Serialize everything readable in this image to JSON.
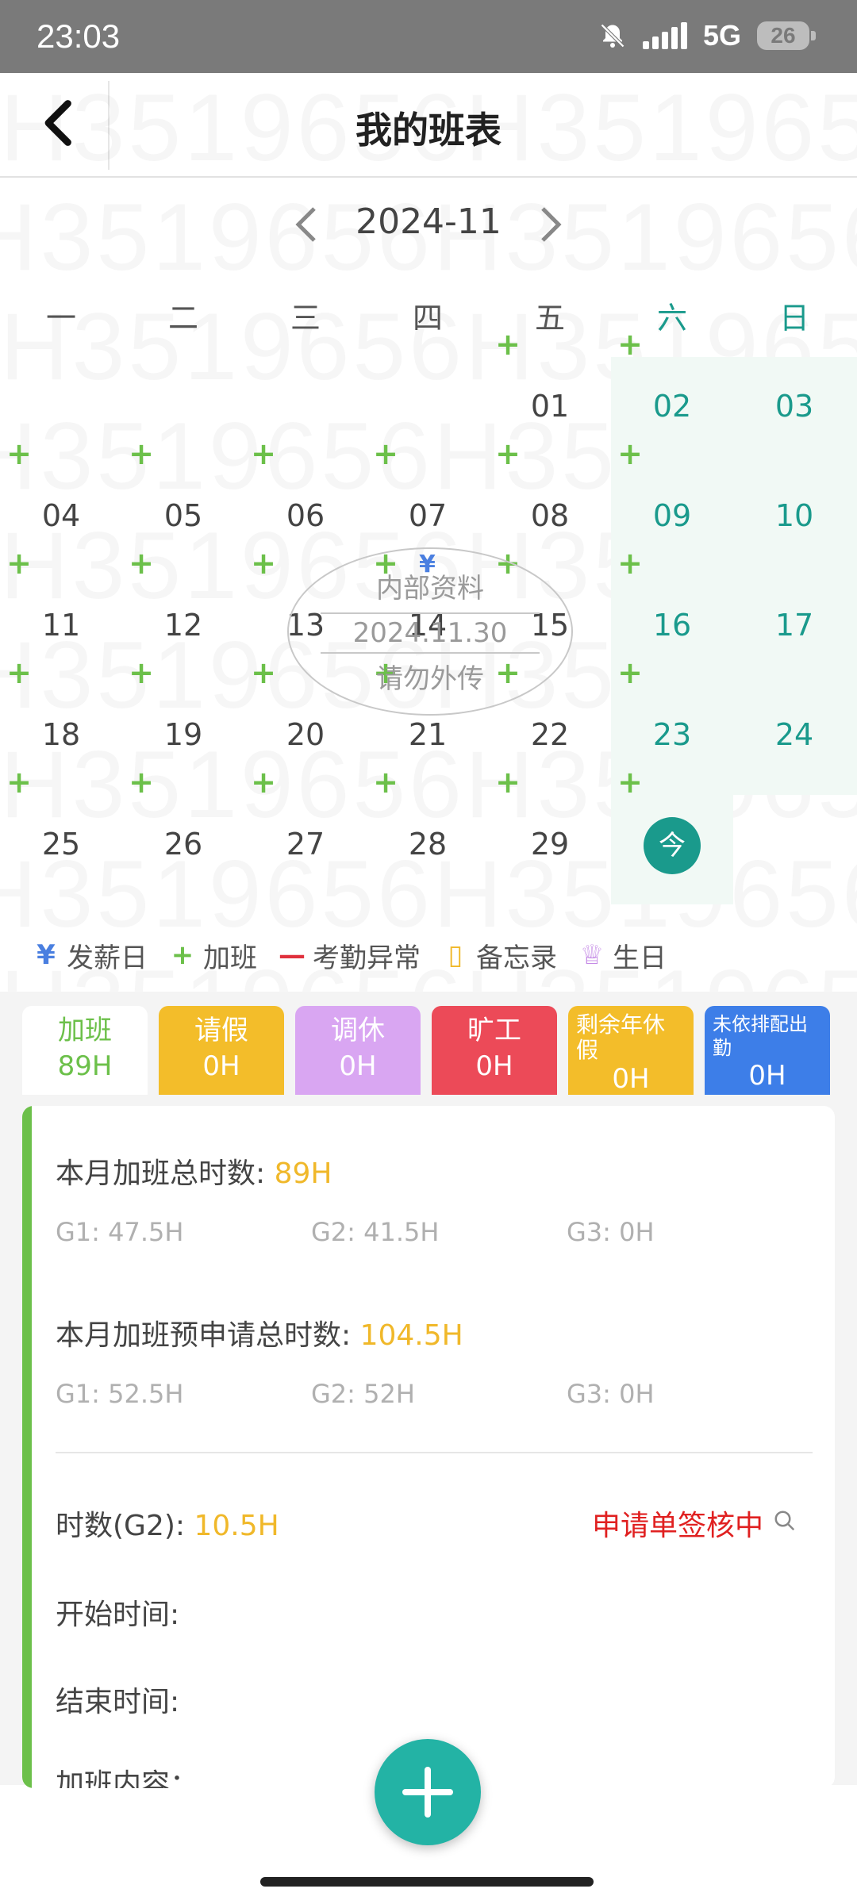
{
  "status_bar": {
    "time": "23:03",
    "network": "5G",
    "battery": "26"
  },
  "header": {
    "title": "我的班表"
  },
  "calendar": {
    "month_label": "2024-11",
    "weekdays": [
      "一",
      "二",
      "三",
      "四",
      "五",
      "六",
      "日"
    ],
    "weeks": [
      [
        "",
        "",
        "",
        "",
        "01",
        "02",
        "03"
      ],
      [
        "04",
        "05",
        "06",
        "07",
        "08",
        "09",
        "10"
      ],
      [
        "11",
        "12",
        "13",
        "14",
        "15",
        "16",
        "17"
      ],
      [
        "18",
        "19",
        "20",
        "21",
        "22",
        "23",
        "24"
      ],
      [
        "25",
        "26",
        "27",
        "28",
        "29",
        "今",
        ""
      ]
    ],
    "plus_glyph": "+"
  },
  "stamp": {
    "line1": "内部资料",
    "line2": "2024.11.30",
    "line3": "请勿外传"
  },
  "watermark": {
    "text": "H3519656H3519656H3519656"
  },
  "legend": [
    {
      "icon": "¥",
      "label": "发薪日",
      "color": "#4a7fe0"
    },
    {
      "icon": "+",
      "label": "加班",
      "color": "#6cc04a"
    },
    {
      "icon": "—",
      "label": "考勤异常",
      "color": "#e0303c"
    },
    {
      "icon": "▯",
      "label": "备忘录",
      "color": "#f0b82a"
    },
    {
      "icon": "♕",
      "label": "生日",
      "color": "#c58be6"
    }
  ],
  "tabs": [
    {
      "label": "加班",
      "value": "89H",
      "color": "#ffffff"
    },
    {
      "label": "请假",
      "value": "0H",
      "color": "#f3bd2a"
    },
    {
      "label": "调休",
      "value": "0H",
      "color": "#d9a6f2"
    },
    {
      "label": "旷工",
      "value": "0H",
      "color": "#ec4a58"
    },
    {
      "label": "剩余年休假",
      "value": "0H",
      "color": "#f3bd2a"
    },
    {
      "label": "未依排配出勤",
      "value": "0H",
      "color": "#3d7ee8"
    }
  ],
  "overtime": {
    "total_label": "本月加班总时数:",
    "total_value": "89H",
    "total_breakdown": [
      "G1: 47.5H",
      "G2: 41.5H",
      "G3: 0H"
    ],
    "apply_label": "本月加班预申请总时数:",
    "apply_value": "104.5H",
    "apply_breakdown": [
      "G1: 52.5H",
      "G2: 52H",
      "G3: 0H"
    ]
  },
  "record": {
    "hours_label": "时数(G2):",
    "hours_value": "10.5H",
    "status": "申请单签核中",
    "start_label": "开始时间:",
    "end_label": "结束时间:",
    "reason_partial": "加班内容：…"
  }
}
